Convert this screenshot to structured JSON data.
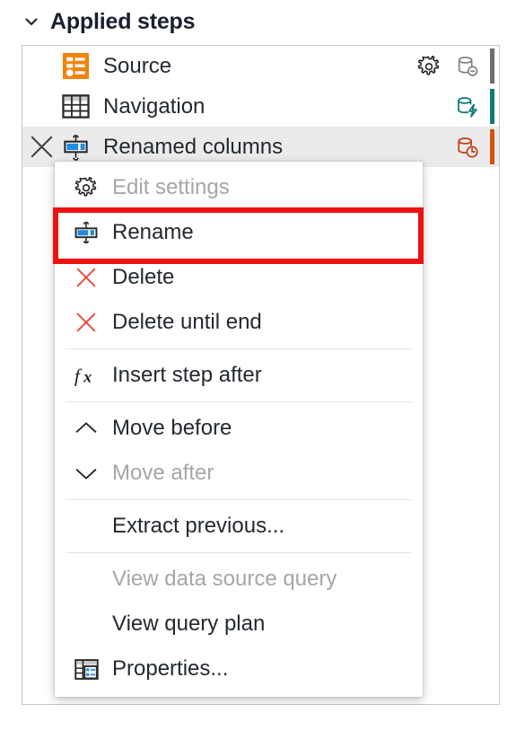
{
  "header": {
    "title": "Applied steps",
    "chevron_icon": "chevron-down-icon",
    "expanded": true
  },
  "colors": {
    "accent_orange": "#f2820a",
    "teal": "#0f7a7a",
    "red_accent": "#c43e1c",
    "gray_bar": "#6e6e6e",
    "highlight_red": "#ee1111",
    "selected_row_bg": "#ebebeb",
    "disabled_text": "#a6a6a6",
    "text": "#24292f",
    "panel_border": "#c8c8c8"
  },
  "steps": {
    "items": [
      {
        "label": "Source",
        "icon": "source-table-icon",
        "selected": false,
        "has_delete": false,
        "has_gear": true,
        "right_icon": "database-disabled-icon",
        "right_icon_color": "#7a7a7a",
        "edge_bar_color": "#6e6e6e"
      },
      {
        "label": "Navigation",
        "icon": "table-grid-icon",
        "selected": false,
        "has_delete": false,
        "has_gear": false,
        "right_icon": "database-folding-icon",
        "right_icon_color": "#0f7a7a",
        "edge_bar_color": "#0f7a7a"
      },
      {
        "label": "Renamed columns",
        "icon": "rename-columns-icon",
        "selected": true,
        "has_delete": true,
        "has_gear": false,
        "right_icon": "database-clock-icon",
        "right_icon_color": "#c43e1c",
        "edge_bar_color": "#d4540b"
      }
    ]
  },
  "context_menu": {
    "highlighted_item": "Rename",
    "groups": [
      {
        "items": [
          {
            "label": "Edit settings",
            "icon": "gear-icon",
            "disabled": true,
            "highlighted": false
          }
        ]
      },
      {
        "items": [
          {
            "label": "Rename",
            "icon": "rename-icon",
            "disabled": false,
            "highlighted": true
          },
          {
            "label": "Delete",
            "icon": "delete-x-icon",
            "disabled": false,
            "highlighted": false
          },
          {
            "label": "Delete until end",
            "icon": "delete-x-icon",
            "disabled": false,
            "highlighted": false
          }
        ]
      },
      {
        "items": [
          {
            "label": "Insert step after",
            "icon": "fx-icon",
            "disabled": false,
            "highlighted": false
          }
        ]
      },
      {
        "items": [
          {
            "label": "Move before",
            "icon": "chevron-up-icon",
            "disabled": false,
            "highlighted": false
          },
          {
            "label": "Move after",
            "icon": "chevron-down-icon",
            "disabled": true,
            "highlighted": false
          }
        ]
      },
      {
        "items": [
          {
            "label": "Extract previous...",
            "icon": "none",
            "disabled": false,
            "highlighted": false
          }
        ]
      },
      {
        "items": [
          {
            "label": "View data source query",
            "icon": "none",
            "disabled": true,
            "highlighted": false
          },
          {
            "label": "View query plan",
            "icon": "none",
            "disabled": false,
            "highlighted": false
          },
          {
            "label": "Properties...",
            "icon": "properties-icon",
            "disabled": false,
            "highlighted": false
          }
        ]
      }
    ]
  }
}
